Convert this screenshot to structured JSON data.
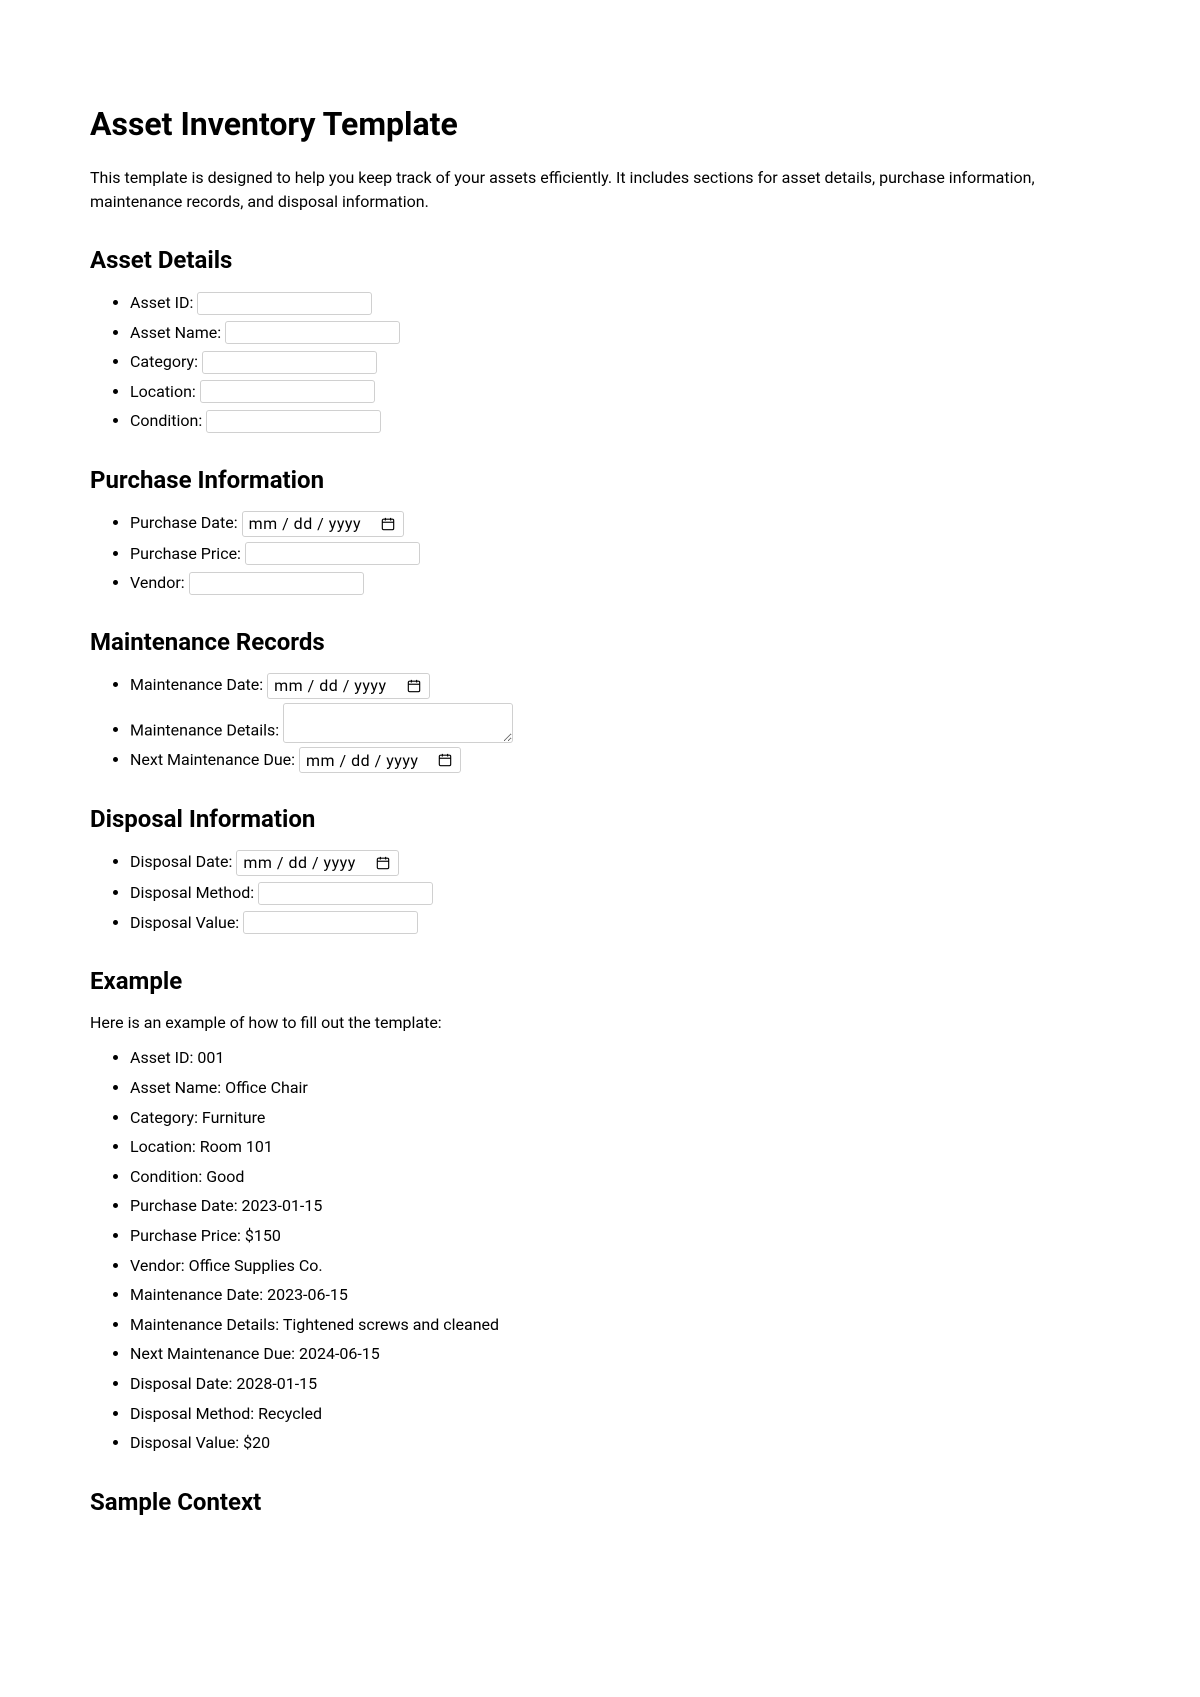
{
  "title": "Asset Inventory Template",
  "intro": "This template is designed to help you keep track of your assets efficiently. It includes sections for asset details, purchase information, maintenance records, and disposal information.",
  "sections": {
    "assetDetails": {
      "heading": "Asset Details",
      "fields": {
        "assetId": "Asset ID:",
        "assetName": "Asset Name:",
        "category": "Category:",
        "location": "Location:",
        "condition": "Condition:"
      }
    },
    "purchaseInfo": {
      "heading": "Purchase Information",
      "fields": {
        "purchaseDate": "Purchase Date:",
        "purchasePrice": "Purchase Price:",
        "vendor": "Vendor:"
      }
    },
    "maintenance": {
      "heading": "Maintenance Records",
      "fields": {
        "maintenanceDate": "Maintenance Date:",
        "maintenanceDetails": "Maintenance Details:",
        "nextMaintenance": "Next Maintenance Due:"
      }
    },
    "disposal": {
      "heading": "Disposal Information",
      "fields": {
        "disposalDate": "Disposal Date:",
        "disposalMethod": "Disposal Method:",
        "disposalValue": "Disposal Value:"
      }
    }
  },
  "datePlaceholder": "mm / dd / yyyy",
  "example": {
    "heading": "Example",
    "intro": "Here is an example of how to fill out the template:",
    "items": [
      "Asset ID: 001",
      "Asset Name: Office Chair",
      "Category: Furniture",
      "Location: Room 101",
      "Condition: Good",
      "Purchase Date: 2023-01-15",
      "Purchase Price: $150",
      "Vendor: Office Supplies Co.",
      "Maintenance Date: 2023-06-15",
      "Maintenance Details: Tightened screws and cleaned",
      "Next Maintenance Due: 2024-06-15",
      "Disposal Date: 2028-01-15",
      "Disposal Method: Recycled",
      "Disposal Value: $20"
    ]
  },
  "sampleContext": {
    "heading": "Sample Context"
  }
}
